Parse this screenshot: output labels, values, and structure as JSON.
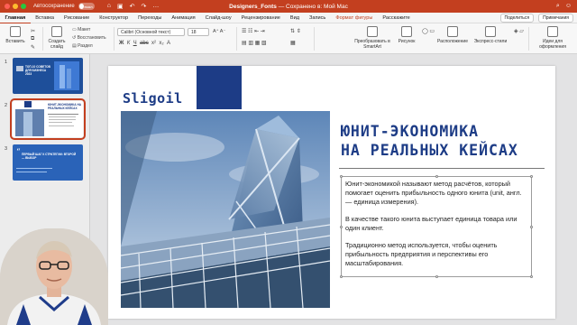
{
  "titlebar": {
    "autosave_label": "Автосохранение",
    "autosave_state": "выкл.",
    "doc_name": "Designers_Fonts",
    "doc_status": "— Сохранено в: Мой Mac"
  },
  "tabs": [
    "Главная",
    "Вставка",
    "Рисование",
    "Конструктор",
    "Переходы",
    "Анимация",
    "Слайд-шоу",
    "Рецензирование",
    "Вид",
    "Запись",
    "Формат фигуры",
    "Расскажите"
  ],
  "share_label": "Поделиться",
  "comments_label": "Примечания",
  "toolbar": {
    "paste": "Вставить",
    "new_slide": "Создать слайд",
    "layout": "Макет",
    "reset": "Восстановить",
    "section": "Раздел",
    "font_name": "Calibri (Основной текст)",
    "font_size": "18",
    "smartart": "Преобразовать в SmartArt",
    "picture": "Рисунок",
    "arrange": "Расположение",
    "quick_styles": "Экспресс-стили",
    "designer": "Идеи для оформления"
  },
  "thumbnails": [
    {
      "num": "1",
      "text": "ТОП-10 СОВЕТОВ ДЛЯ БИЗНЕСА 2023"
    },
    {
      "num": "2",
      "text": "ЮНИТ-ЭКОНОМИКА НА РЕАЛЬНЫХ КЕЙСАХ"
    },
    {
      "num": "3",
      "text": "ПЕРВЫЙ ШАГ К СТРАТЕГИИ: ВТОРОЙ — ВЫБОР"
    }
  ],
  "slide": {
    "logo": "Sligoil",
    "heading_line1": "ЮНИТ-ЭКОНОМИКА",
    "heading_line2": "НА РЕАЛЬНЫХ КЕЙСАХ",
    "para1": "Юнит-экономикой называют метод расчётов, который помогает оценить прибыльность одного юнита (unit, англ. — единица измерения).",
    "para2": "В качестве такого юнита выступает единица товара или один клиент.",
    "para3": "Традиционно метод используется, чтобы оценить прибыльность предприятия и перспективы его масштабирования."
  },
  "colors": {
    "brand": "#c33f1f",
    "slide_accent": "#1d3c86"
  }
}
